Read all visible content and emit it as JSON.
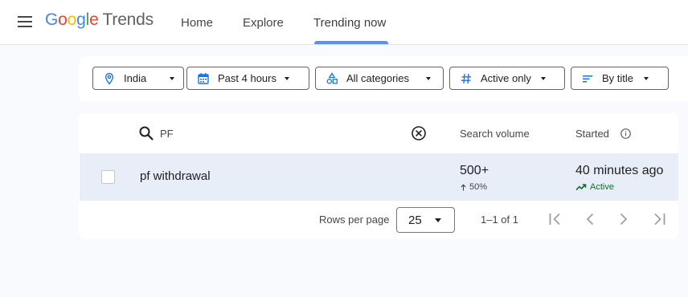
{
  "header": {
    "logo_letters": [
      {
        "ch": "G",
        "color": "#4285f4"
      },
      {
        "ch": "o",
        "color": "#ea4335"
      },
      {
        "ch": "o",
        "color": "#fbbc04"
      },
      {
        "ch": "g",
        "color": "#4285f4"
      },
      {
        "ch": "l",
        "color": "#34a853"
      },
      {
        "ch": "e",
        "color": "#ea4335"
      }
    ],
    "logo_suffix": "Trends",
    "nav": {
      "home": "Home",
      "explore": "Explore",
      "trending_now": "Trending now"
    },
    "active_tab": "trending_now",
    "accent": "#5e8ff0"
  },
  "filters": {
    "location": "India",
    "time": "Past 4 hours",
    "category": "All categories",
    "status": "Active only",
    "sort": "By title"
  },
  "table": {
    "search_query": "PF",
    "columns": {
      "search_volume": "Search volume",
      "started": "Started"
    },
    "rows": [
      {
        "trend": "pf withdrawal",
        "volume": "500+",
        "volume_change": "50%",
        "started": "40 minutes ago",
        "status": "Active"
      }
    ],
    "status_color": "#146c2e",
    "row_highlight": "#e8eef7"
  },
  "pagination": {
    "rows_per_page_label": "Rows per page",
    "rows_per_page": "25",
    "range": "1–1 of 1"
  }
}
